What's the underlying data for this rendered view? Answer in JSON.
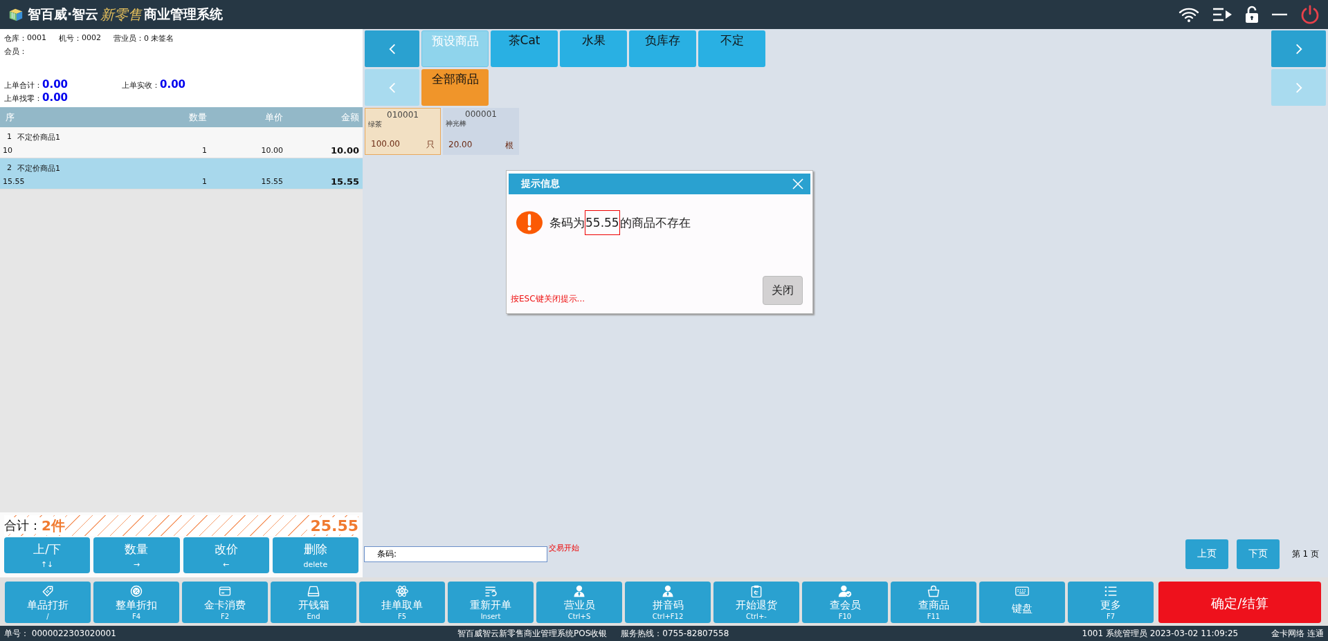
{
  "app_title": {
    "brand": "智百威·智云",
    "script": "新零售",
    "suffix": "商业管理系统"
  },
  "info": {
    "fields": [
      {
        "label": "仓库：",
        "value": "0001"
      },
      {
        "label": "机号：",
        "value": "0002"
      },
      {
        "label": "营业员：",
        "value": "0 未签名"
      }
    ],
    "member_label": "会员："
  },
  "last_order": [
    {
      "label": "上单合计：",
      "value": "0.00"
    },
    {
      "label": "上单实收：",
      "value": "0.00"
    },
    {
      "label": "上单找零：",
      "value": "0.00"
    }
  ],
  "table": {
    "columns": [
      "序",
      "数量",
      "单价",
      "金额"
    ],
    "rows": [
      {
        "index": "1",
        "name": "不定价商品1",
        "code": "10",
        "qty": "1",
        "price": "10.00",
        "amount": "10.00",
        "selected": false
      },
      {
        "index": "2",
        "name": "不定价商品1",
        "code": "15.55",
        "qty": "1",
        "price": "15.55",
        "amount": "15.55",
        "selected": true
      }
    ]
  },
  "summary": {
    "label": "合计：",
    "count": "2件",
    "total": "25.55"
  },
  "actions": [
    {
      "label": "上/下",
      "key": "↑↓"
    },
    {
      "label": "数量",
      "key": "→"
    },
    {
      "label": "改价",
      "key": "←"
    },
    {
      "label": "删除",
      "key": "delete"
    }
  ],
  "categories": [
    {
      "kind": "main",
      "disabled": false,
      "tabs": [
        {
          "label": "预设商品",
          "selected": true
        },
        {
          "label": "茶Cat",
          "selected": false
        },
        {
          "label": "水果",
          "selected": false
        },
        {
          "label": "负库存",
          "selected": false
        },
        {
          "label": "不定",
          "selected": false
        }
      ]
    },
    {
      "kind": "sub",
      "disabled": true,
      "tabs": [
        {
          "label": "全部商品",
          "selected": true
        }
      ]
    }
  ],
  "products": [
    {
      "code": "010001",
      "name": "绿茶",
      "price": "100.00",
      "unit": "只",
      "selected": true
    },
    {
      "code": "000001",
      "name": "神光棒",
      "price": "20.00",
      "unit": "根",
      "selected": false
    }
  ],
  "dialog": {
    "title": "提示信息",
    "message": {
      "before": "条码为",
      "highlight": "55.55",
      "after": "的商品不存在"
    },
    "hint": "按ESC键关闭提示...",
    "button": "关闭"
  },
  "barcode": {
    "label": "条码:",
    "status": "交易开始"
  },
  "pager": {
    "prev": "上页",
    "next": "下页",
    "page": "第 1 页"
  },
  "toolbar": [
    {
      "kind": "tag",
      "label": "单品打折",
      "key": "/"
    },
    {
      "kind": "percent",
      "label": "整单折扣",
      "key": "F4"
    },
    {
      "kind": "card",
      "label": "金卡消费",
      "key": "F2"
    },
    {
      "kind": "drawer",
      "label": "开钱箱",
      "key": "End"
    },
    {
      "kind": "atom",
      "label": "挂单取单",
      "key": "F5"
    },
    {
      "kind": "reorder",
      "label": "重新开单",
      "key": "Insert"
    },
    {
      "kind": "person",
      "label": "营业员",
      "key": "Ctrl+S"
    },
    {
      "kind": "person",
      "label": "拼音码",
      "key": "Ctrl+F12"
    },
    {
      "kind": "clipboard",
      "label": "开始退货",
      "key": "Ctrl+-"
    },
    {
      "kind": "member",
      "label": "查会员",
      "key": "F10"
    },
    {
      "kind": "basket",
      "label": "查商品",
      "key": "F11"
    },
    {
      "kind": "keyboard",
      "label": "键盘"
    },
    {
      "kind": "list",
      "label": "更多",
      "key": "F7"
    }
  ],
  "confirm_button": "确定/结算",
  "status_bar": {
    "order": "单号： 0000022303020001",
    "system": "智百威智云新零售商业管理系统POS收银",
    "hotline": "服务热线：0755-82807558",
    "user": "1001 系统管理员 2023-03-02 11:09:25",
    "network": "金卡网络 连通"
  }
}
